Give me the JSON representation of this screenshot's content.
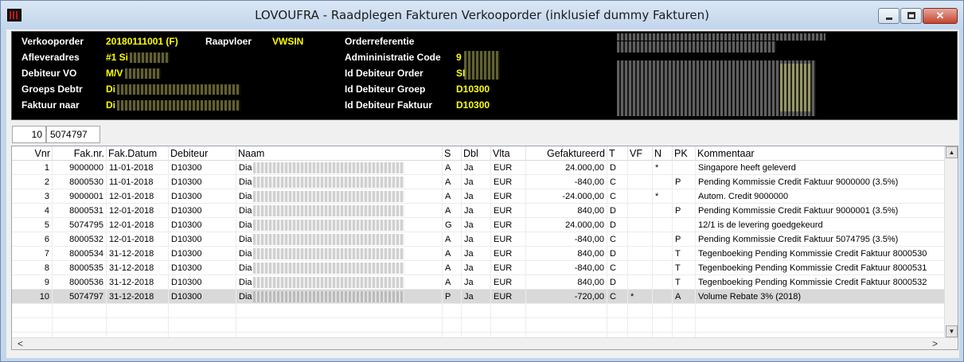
{
  "window": {
    "title": "LOVOUFRA - Raadplegen Fakturen Verkooporder (inklusief dummy Fakturen)",
    "min_glyph": "",
    "max_glyph": "",
    "close_glyph": "✕"
  },
  "info": {
    "verkooporder_label": "Verkooporder",
    "verkooporder_value": "20180111001 (F)",
    "raapvloer_label": "Raapvloer",
    "raapvloer_value": "VWSIN",
    "orderreferentie_label": "Orderreferentie",
    "afleveradres_label": "Afleveradres",
    "afleveradres_value": "#1 Si",
    "administratie_label": "Admininistratie Code",
    "administratie_value": "9",
    "debiteur_vo_label": "Debiteur VO",
    "debiteur_vo_value": "M/V",
    "id_debiteur_order_label": "Id Debiteur Order",
    "id_debiteur_order_value": "SI",
    "groeps_debtr_label": "Groeps Debtr",
    "groeps_debtr_value": "Di",
    "id_debiteur_groep_label": "Id Debiteur Groep",
    "id_debiteur_groep_value": "D10300",
    "faktuur_naar_label": "Faktuur naar",
    "faktuur_naar_value": "Di",
    "id_debiteur_faktuur_label": "Id Debiteur Faktuur",
    "id_debiteur_faktuur_value": "D10300"
  },
  "counts": {
    "left": "10",
    "right": "5074797"
  },
  "columns": [
    "Vnr",
    "Fak.nr.",
    "Fak.Datum",
    "Debiteur",
    "Naam",
    "S",
    "Dbl",
    "Vlta",
    "Gefaktureerd",
    "T",
    "VF",
    "N",
    "PK",
    "Kommentaar"
  ],
  "rows": [
    {
      "vnr": "1",
      "faknr": "9000000",
      "datum": "11-01-2018",
      "debiteur": "D10300",
      "naam": "Dia",
      "s": "A",
      "dbl": "Ja",
      "vlta": "EUR",
      "bedrag": "24.000,00",
      "t": "D",
      "vf": "",
      "n": "*",
      "pk": "",
      "komm": "Singapore heeft geleverd"
    },
    {
      "vnr": "2",
      "faknr": "8000530",
      "datum": "11-01-2018",
      "debiteur": "D10300",
      "naam": "Dia",
      "s": "A",
      "dbl": "Ja",
      "vlta": "EUR",
      "bedrag": "-840,00",
      "t": "C",
      "vf": "",
      "n": "",
      "pk": "P",
      "komm": "Pending Kommissie Credit Faktuur 9000000 (3.5%)"
    },
    {
      "vnr": "3",
      "faknr": "9000001",
      "datum": "12-01-2018",
      "debiteur": "D10300",
      "naam": "Dia",
      "s": "A",
      "dbl": "Ja",
      "vlta": "EUR",
      "bedrag": "-24.000,00",
      "t": "C",
      "vf": "",
      "n": "*",
      "pk": "",
      "komm": "Autom. Credit 9000000"
    },
    {
      "vnr": "4",
      "faknr": "8000531",
      "datum": "12-01-2018",
      "debiteur": "D10300",
      "naam": "Dia",
      "s": "A",
      "dbl": "Ja",
      "vlta": "EUR",
      "bedrag": "840,00",
      "t": "D",
      "vf": "",
      "n": "",
      "pk": "P",
      "komm": "Pending Kommissie Credit Faktuur 9000001 (3.5%)"
    },
    {
      "vnr": "5",
      "faknr": "5074795",
      "datum": "12-01-2018",
      "debiteur": "D10300",
      "naam": "Dia",
      "s": "G",
      "dbl": "Ja",
      "vlta": "EUR",
      "bedrag": "24.000,00",
      "t": "D",
      "vf": "",
      "n": "",
      "pk": "",
      "komm": "12/1 is de levering goedgekeurd"
    },
    {
      "vnr": "6",
      "faknr": "8000532",
      "datum": "12-01-2018",
      "debiteur": "D10300",
      "naam": "Dia",
      "s": "A",
      "dbl": "Ja",
      "vlta": "EUR",
      "bedrag": "-840,00",
      "t": "C",
      "vf": "",
      "n": "",
      "pk": "P",
      "komm": "Pending Kommissie Credit Faktuur 5074795 (3.5%)"
    },
    {
      "vnr": "7",
      "faknr": "8000534",
      "datum": "31-12-2018",
      "debiteur": "D10300",
      "naam": "Dia",
      "s": "A",
      "dbl": "Ja",
      "vlta": "EUR",
      "bedrag": "840,00",
      "t": "D",
      "vf": "",
      "n": "",
      "pk": "T",
      "komm": "Tegenboeking Pending Kommissie Credit Faktuur 8000530"
    },
    {
      "vnr": "8",
      "faknr": "8000535",
      "datum": "31-12-2018",
      "debiteur": "D10300",
      "naam": "Dia",
      "s": "A",
      "dbl": "Ja",
      "vlta": "EUR",
      "bedrag": "-840,00",
      "t": "C",
      "vf": "",
      "n": "",
      "pk": "T",
      "komm": "Tegenboeking Pending Kommissie Credit Faktuur 8000531"
    },
    {
      "vnr": "9",
      "faknr": "8000536",
      "datum": "31-12-2018",
      "debiteur": "D10300",
      "naam": "Dia",
      "s": "A",
      "dbl": "Ja",
      "vlta": "EUR",
      "bedrag": "840,00",
      "t": "D",
      "vf": "",
      "n": "",
      "pk": "T",
      "komm": "Tegenboeking Pending Kommissie Credit Faktuur 8000532"
    },
    {
      "vnr": "10",
      "faknr": "5074797",
      "datum": "31-12-2018",
      "debiteur": "D10300",
      "naam": "Dia",
      "s": "P",
      "dbl": "Ja",
      "vlta": "EUR",
      "bedrag": "-720,00",
      "t": "C",
      "vf": "*",
      "n": "",
      "pk": "A",
      "komm": "Volume Rebate 3% (2018)"
    }
  ],
  "scroll": {
    "up": "▲",
    "down": "▼",
    "left": "<",
    "right": ">"
  },
  "colors": {
    "info_bg": "#000000",
    "label": "#ffffff",
    "value": "#ffff00",
    "selected_row": "#d9d9d9"
  }
}
